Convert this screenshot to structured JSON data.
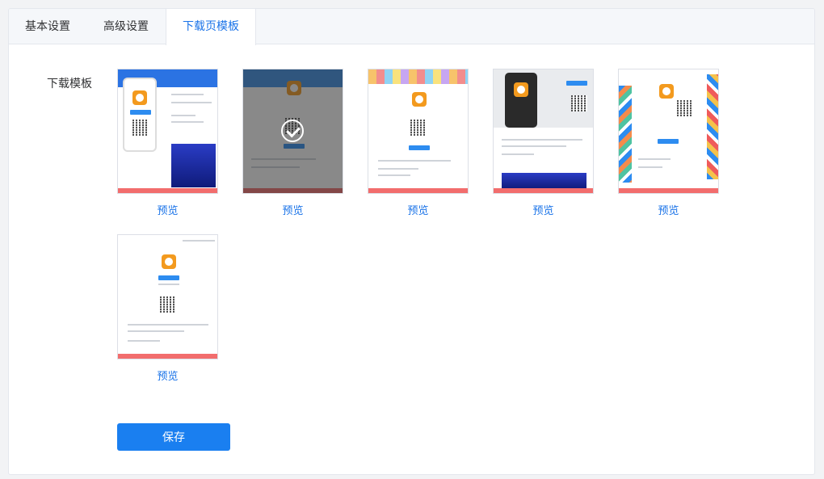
{
  "tabs": [
    {
      "label": "基本设置",
      "active": false
    },
    {
      "label": "高级设置",
      "active": false
    },
    {
      "label": "下载页模板",
      "active": true
    }
  ],
  "section": {
    "label": "下载模板"
  },
  "templates": [
    {
      "id": 1,
      "preview_label": "预览",
      "selected": false
    },
    {
      "id": 2,
      "preview_label": "预览",
      "selected": true
    },
    {
      "id": 3,
      "preview_label": "预览",
      "selected": false
    },
    {
      "id": 4,
      "preview_label": "预览",
      "selected": false
    },
    {
      "id": 5,
      "preview_label": "预览",
      "selected": false
    },
    {
      "id": 6,
      "preview_label": "预览",
      "selected": false
    }
  ],
  "save_label": "保存",
  "colors": {
    "accent": "#1a73e8",
    "save_button": "#1a7ff0",
    "footer_bar": "#f26d6d"
  }
}
